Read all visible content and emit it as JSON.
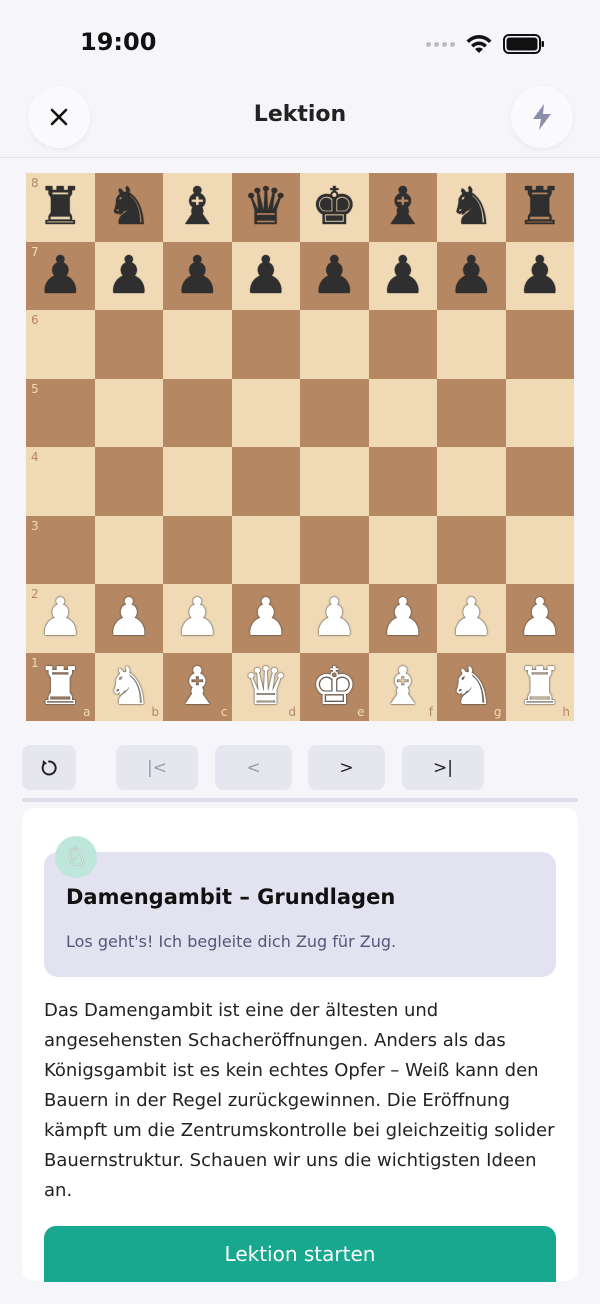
{
  "status_bar": {
    "time": "19:00"
  },
  "header": {
    "title": "Lektion",
    "close_icon": "close-icon",
    "action_icon": "lightning-icon"
  },
  "board": {
    "ranks": [
      "8",
      "7",
      "6",
      "5",
      "4",
      "3",
      "2",
      "1"
    ],
    "files": [
      "a",
      "b",
      "c",
      "d",
      "e",
      "f",
      "g",
      "h"
    ],
    "position": [
      [
        "bR",
        "bN",
        "bB",
        "bQ",
        "bK",
        "bB",
        "bN",
        "bR"
      ],
      [
        "bP",
        "bP",
        "bP",
        "bP",
        "bP",
        "bP",
        "bP",
        "bP"
      ],
      [
        "",
        "",
        "",
        "",
        "",
        "",
        "",
        ""
      ],
      [
        "",
        "",
        "",
        "",
        "",
        "",
        "",
        ""
      ],
      [
        "",
        "",
        "",
        "",
        "",
        "",
        "",
        ""
      ],
      [
        "",
        "",
        "",
        "",
        "",
        "",
        "",
        ""
      ],
      [
        "wP",
        "wP",
        "wP",
        "wP",
        "wP",
        "wP",
        "wP",
        "wP"
      ],
      [
        "wR",
        "wN",
        "wB",
        "wQ",
        "wK",
        "wB",
        "wN",
        "wR"
      ]
    ],
    "colors": {
      "light": "#f0d9b5",
      "dark": "#b58863"
    }
  },
  "controls": {
    "reset_icon": "rotate-icon",
    "first": "|<",
    "prev": "<",
    "next": ">",
    "last": ">|"
  },
  "lesson": {
    "avatar_icon": "chess-knight-avatar-icon",
    "title": "Damengambit – Grundlagen",
    "subtitle": "Los geht's! Ich begleite dich Zug für Zug.",
    "description": "Das Damengambit ist eine der ältesten und angesehensten Schacheröffnungen. Anders als das Königsgambit ist es kein echtes Opfer – Weiß kann den Bauern in der Regel zurückgewinnen. Die Eröffnung kämpft um die Zentrumskontrolle bei gleichzeitig solider Bauernstruktur. Schauen wir uns die wichtigsten Ideen an.",
    "start_button": "Lektion starten"
  },
  "colors": {
    "accent": "#17a88f",
    "card": "#e2e2f0",
    "control": "#e6e6ef"
  }
}
